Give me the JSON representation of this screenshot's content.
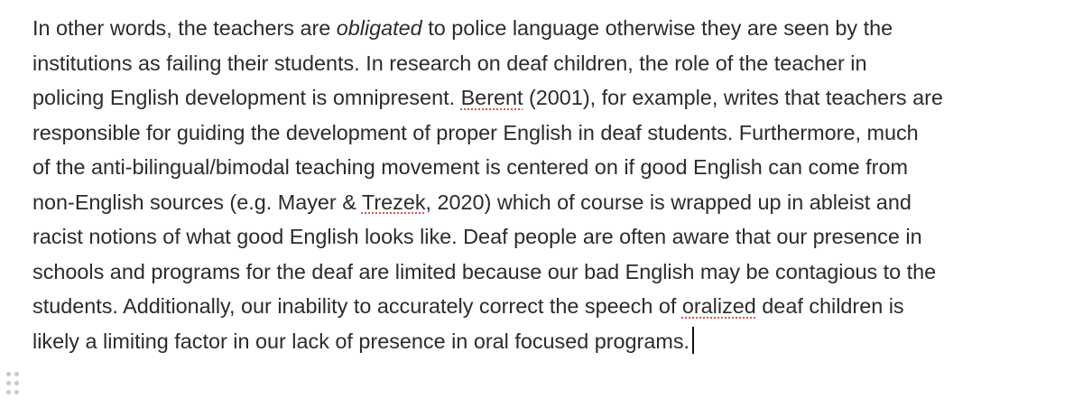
{
  "paragraph": {
    "l1": {
      "a": "In other words, the teachers are ",
      "em": "obligated",
      "b": " to police language otherwise they are seen by the"
    },
    "l2": "institutions as failing their students. In research on deaf children, the role of the teacher in",
    "l3": {
      "a": "policing English development is omnipresent. ",
      "flag": "Berent",
      "b": " (2001), for example, writes that teachers are"
    },
    "l4": "responsible for guiding the development of proper English in deaf students. Furthermore, much",
    "l5": "of the anti-bilingual/bimodal teaching movement is centered on if good English can come from",
    "l6": {
      "a": "non-English sources (e.g. Mayer & ",
      "flag": "Trezek",
      "b": ", 2020) which of course is wrapped up in ableist and"
    },
    "l7": "racist notions of what good English looks like. Deaf people are often aware that our presence in",
    "l8": "schools and programs for the deaf are limited because our bad English may be contagious to the",
    "l9": {
      "a": "students. Additionally, our inability to accurately correct the speech of ",
      "flag": "oralized",
      "b": " deaf children is"
    },
    "l10": "likely a limiting factor in our lack of presence in oral focused programs."
  },
  "icons": {
    "block_handle": "drag-handle-icon"
  },
  "colors": {
    "text": "#2b2b2b",
    "spellcheck_underline": "#d9534f",
    "handle": "#c8c8c8"
  }
}
